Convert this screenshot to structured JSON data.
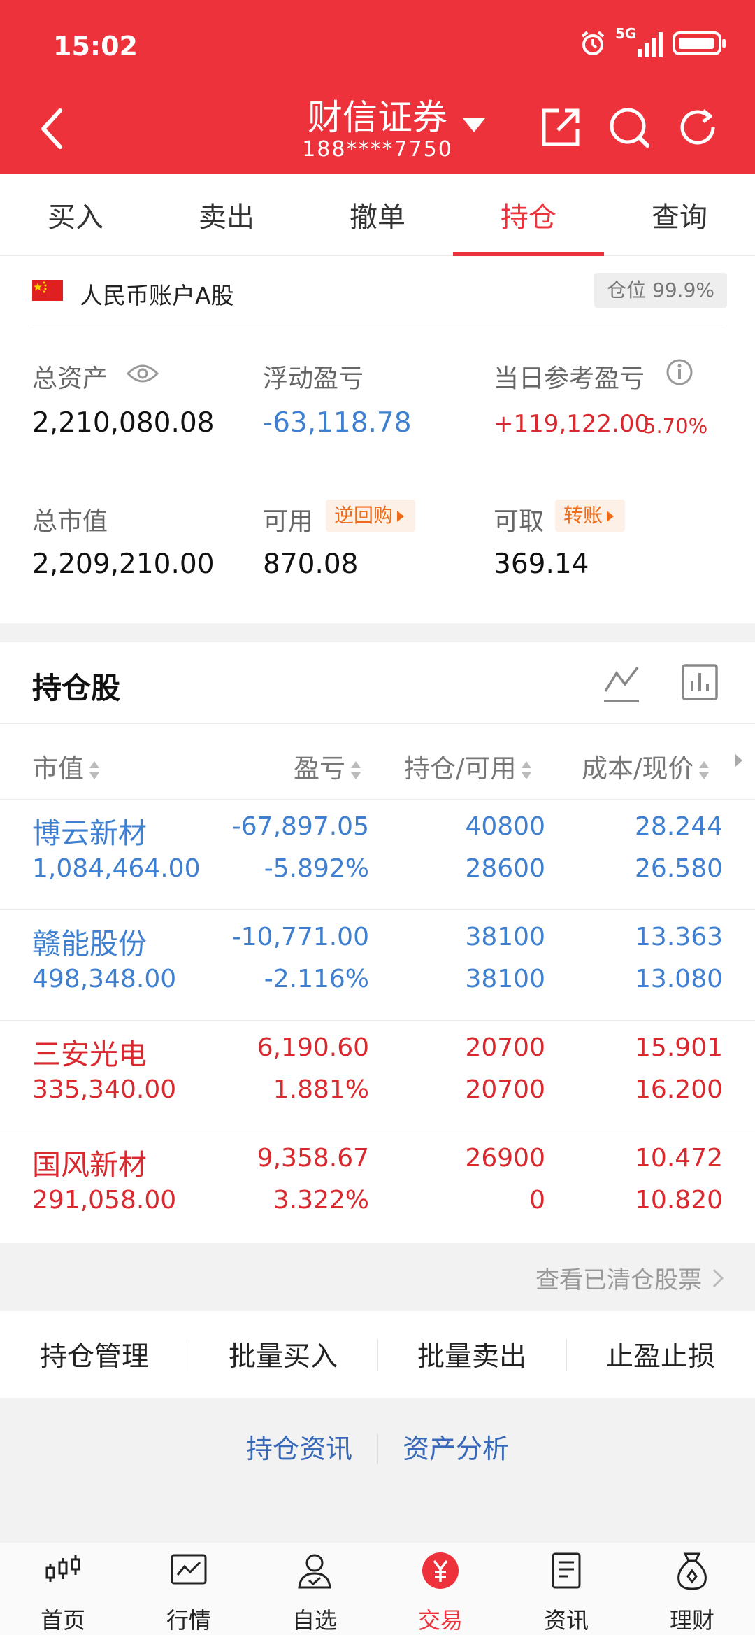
{
  "status": {
    "time": "15:02",
    "network": "5G"
  },
  "header": {
    "title": "财信证券",
    "account": "188****7750"
  },
  "tabs": [
    "买入",
    "卖出",
    "撤单",
    "持仓",
    "查询"
  ],
  "account": {
    "label": "人民币账户A股",
    "position_badge": "仓位 99.9%",
    "total_assets_label": "总资产",
    "total_assets": "2,210,080.08",
    "floating_pl_label": "浮动盈亏",
    "floating_pl": "-63,118.78",
    "daily_pl_label": "当日参考盈亏",
    "daily_pl": "+119,122.00",
    "daily_pl_pct": "5.70%",
    "market_value_label": "总市值",
    "market_value": "2,209,210.00",
    "available_label": "可用",
    "available": "870.08",
    "repo_chip": "逆回购",
    "withdrawable_label": "可取",
    "withdrawable": "369.14",
    "transfer_chip": "转账"
  },
  "holdings": {
    "title": "持仓股",
    "columns": [
      "市值",
      "盈亏",
      "持仓/可用",
      "成本/现价"
    ],
    "rows": [
      {
        "name": "博云新材",
        "market_value": "1,084,464.00",
        "pl": "-67,897.05",
        "pl_pct": "-5.892%",
        "position": "40800",
        "available": "28600",
        "cost": "28.244",
        "price": "26.580",
        "color": "blue"
      },
      {
        "name": "赣能股份",
        "market_value": "498,348.00",
        "pl": "-10,771.00",
        "pl_pct": "-2.116%",
        "position": "38100",
        "available": "38100",
        "cost": "13.363",
        "price": "13.080",
        "color": "blue"
      },
      {
        "name": "三安光电",
        "market_value": "335,340.00",
        "pl": "6,190.60",
        "pl_pct": "1.881%",
        "position": "20700",
        "available": "20700",
        "cost": "15.901",
        "price": "16.200",
        "color": "red"
      },
      {
        "name": "国风新材",
        "market_value": "291,058.00",
        "pl": "9,358.67",
        "pl_pct": "3.322%",
        "position": "26900",
        "available": "0",
        "cost": "10.472",
        "price": "10.820",
        "color": "red"
      }
    ]
  },
  "cleared_link": "查看已清仓股票",
  "actions": [
    "持仓管理",
    "批量买入",
    "批量卖出",
    "止盈止损"
  ],
  "links": [
    "持仓资讯",
    "资产分析"
  ],
  "bottom_nav": [
    "首页",
    "行情",
    "自选",
    "交易",
    "资讯",
    "理财"
  ],
  "colors": {
    "brand_red": "#ee323b",
    "loss_blue": "#3f7fd0",
    "gain_red": "#d9292f",
    "chip_orange": "#ee6b18"
  }
}
